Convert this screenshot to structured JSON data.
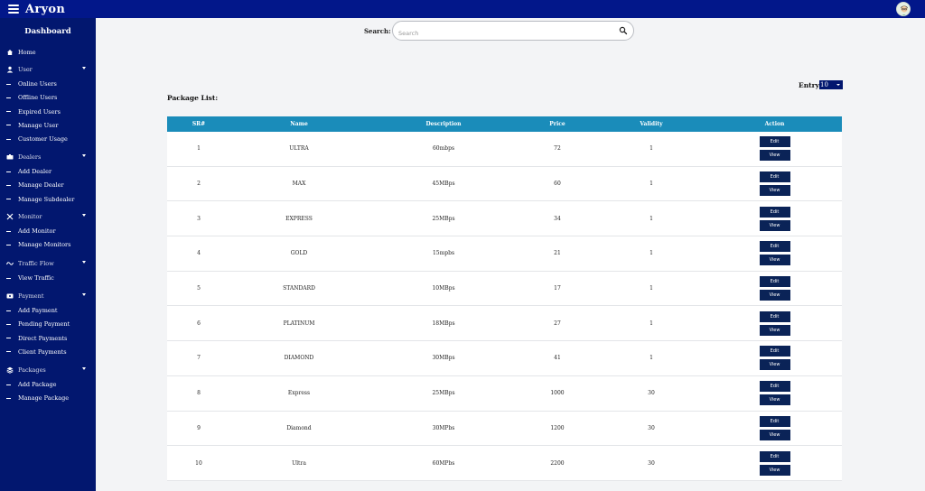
{
  "app": {
    "brand": "Aryon"
  },
  "search": {
    "label": "Search:",
    "placeholder": "Search"
  },
  "sidebar": {
    "title": "Dashboard",
    "home": "Home",
    "sections": [
      {
        "label": "User",
        "icon": "user-icon",
        "items": [
          "Online Users",
          "Offline Users",
          "Expired Users",
          "Manage User",
          "Customer Usage"
        ]
      },
      {
        "label": "Dealers",
        "icon": "dealers-icon",
        "items": [
          "Add Dealer",
          "Manage Dealer",
          "Manage Subdealer"
        ]
      },
      {
        "label": "Monitor",
        "icon": "monitor-icon",
        "items": [
          "Add Monitor",
          "Manage Monitors"
        ]
      },
      {
        "label": "Traffic Flow",
        "icon": "traffic-icon",
        "items": [
          "View Traffic"
        ]
      },
      {
        "label": "Payment",
        "icon": "payment-icon",
        "items": [
          "Add Payment",
          "Pending Payment",
          "Direct Payments",
          "Client Payments"
        ]
      },
      {
        "label": "Packages",
        "icon": "packages-icon",
        "items": [
          "Add Package",
          "Manage Package"
        ]
      }
    ]
  },
  "main": {
    "package_list_title": "Package List:",
    "entry_label": "Entry:",
    "entry_value": "10",
    "table": {
      "headers": [
        "SR#",
        "Name",
        "Description",
        "Price",
        "Validity",
        "Action"
      ],
      "rows": [
        [
          "1",
          "ULTRA",
          "60mbps",
          "72",
          "1"
        ],
        [
          "2",
          "MAX",
          "45MBps",
          "60",
          "1"
        ],
        [
          "3",
          "EXPRESS",
          "25MBps",
          "34",
          "1"
        ],
        [
          "4",
          "GOLD",
          "15mpbs",
          "21",
          "1"
        ],
        [
          "5",
          "STANDARD",
          "10MBps",
          "17",
          "1"
        ],
        [
          "6",
          "PLATINUM",
          "18MBps",
          "27",
          "1"
        ],
        [
          "7",
          "DIAMOND",
          "30MBps",
          "41",
          "1"
        ],
        [
          "8",
          "Express",
          "25MBps",
          "1000",
          "30"
        ],
        [
          "9",
          "Diamond",
          "30MPbs",
          "1200",
          "30"
        ],
        [
          "10",
          "Ultra",
          "60MPbs",
          "2200",
          "30"
        ]
      ],
      "edit_label": "Edit",
      "view_label": "View"
    }
  },
  "colors": {
    "topbar": "#02178a",
    "sidebar": "#02176f",
    "table_header": "#1a8cba",
    "button": "#0a2357"
  }
}
